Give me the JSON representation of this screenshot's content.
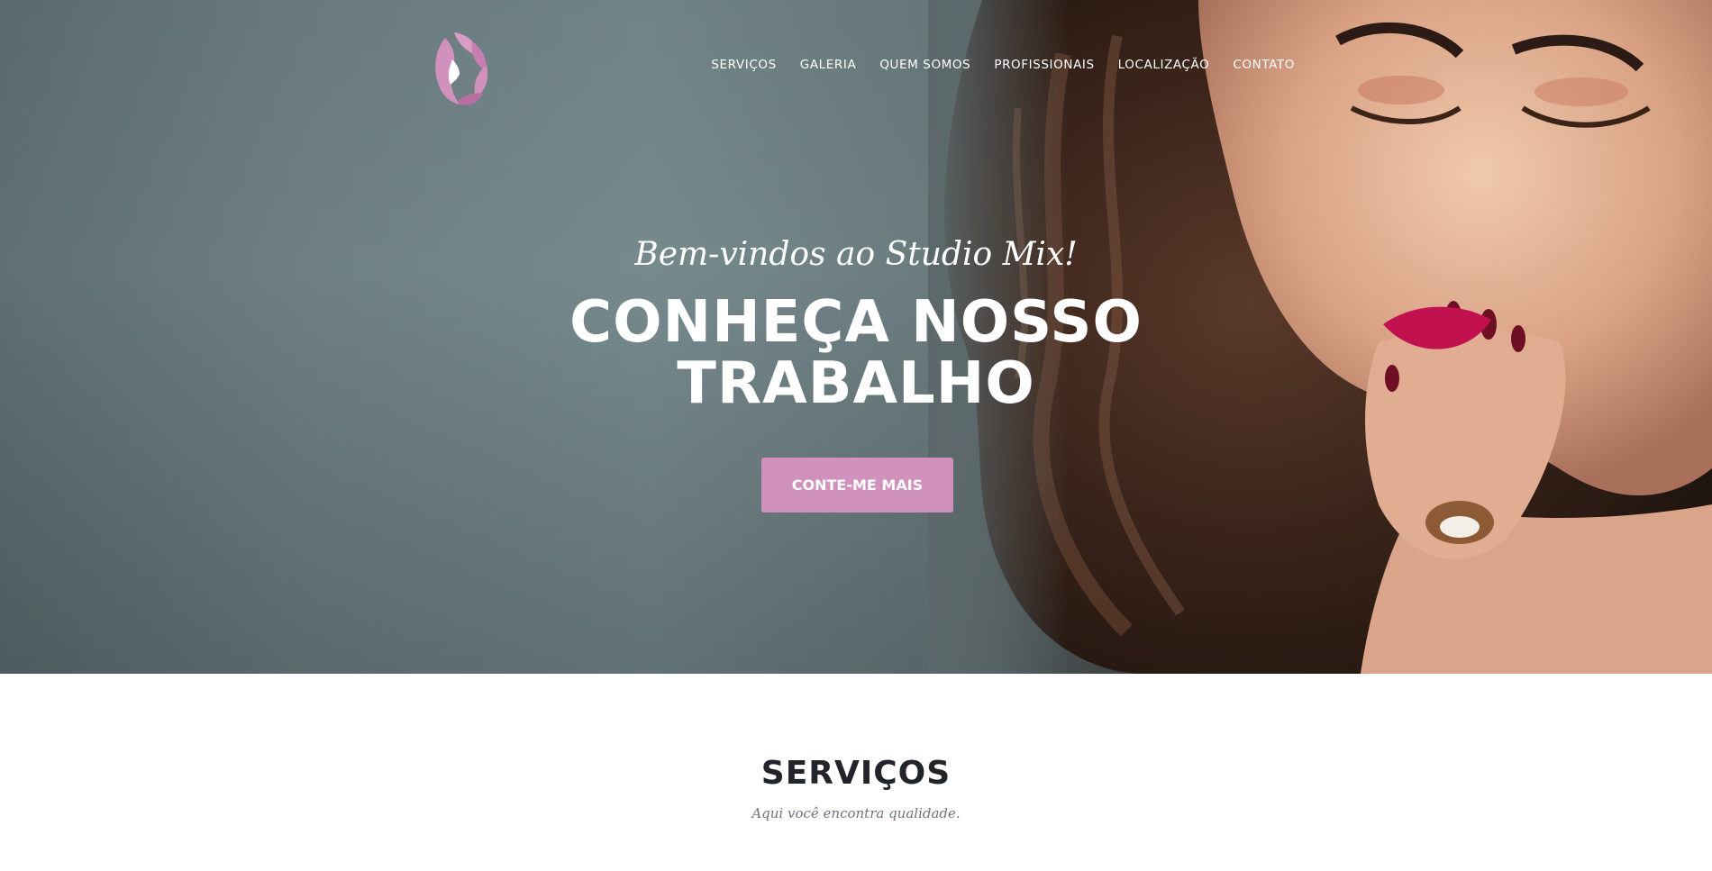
{
  "brand": {
    "logo_icon": "lotus-woman-logo",
    "accent_color": "#d191bd"
  },
  "nav": {
    "items": [
      {
        "label": "SERVIÇOS"
      },
      {
        "label": "GALERIA"
      },
      {
        "label": "QUEM SOMOS"
      },
      {
        "label": "PROFISSIONAIS"
      },
      {
        "label": "LOCALIZAÇÃO"
      },
      {
        "label": "CONTATO"
      }
    ]
  },
  "hero": {
    "welcome": "Bem-vindos ao Studio Mix!",
    "headline_line1": "CONHEÇA NOSSO",
    "headline_line2": "TRABALHO",
    "cta_label": "CONTE-ME MAIS",
    "photo": "woman-portrait-photo"
  },
  "services": {
    "title": "SERVIÇOS",
    "subtitle": "Aqui você encontra qualidade."
  }
}
